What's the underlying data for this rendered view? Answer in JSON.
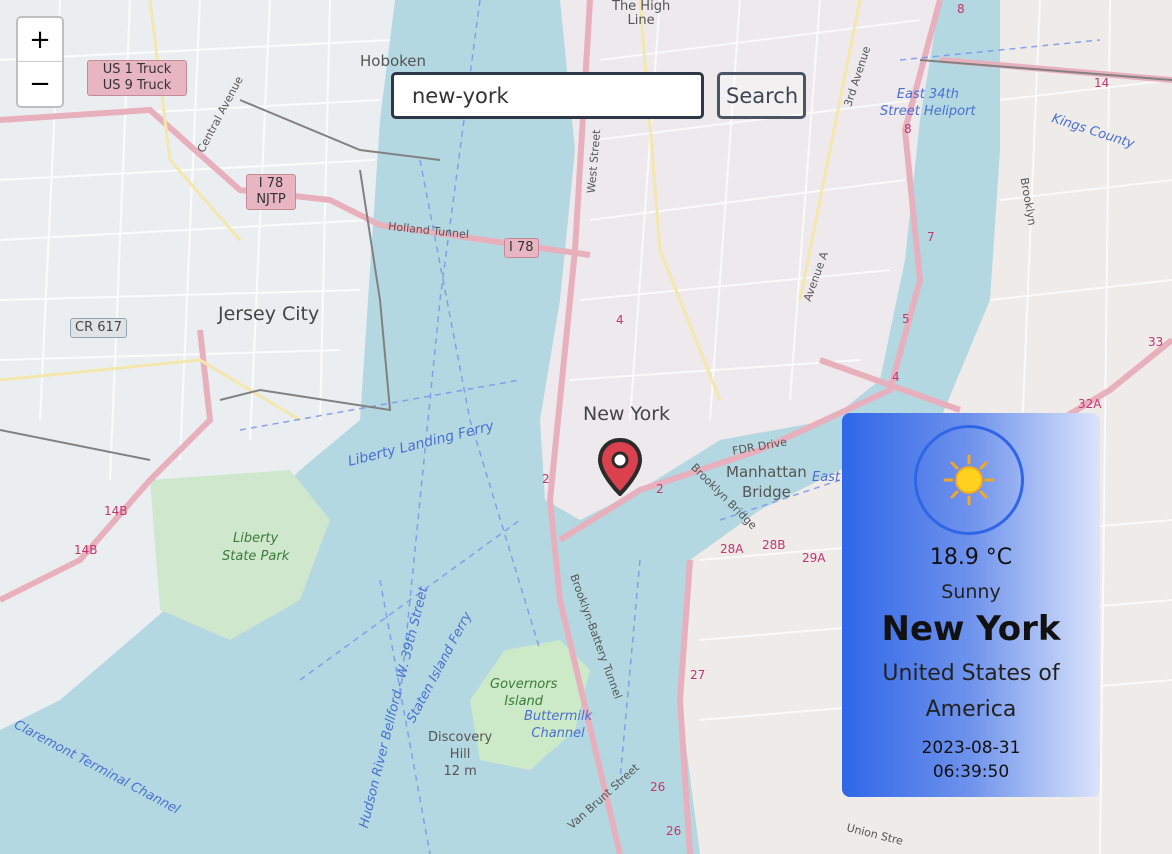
{
  "map": {
    "place_labels": {
      "hoboken": "Hoboken",
      "jersey_city": "Jersey City",
      "new_york": "New York",
      "manhattan_bridge": "Manhattan\nBridge",
      "the_high_line": "The High\nLine",
      "liberty_state_park": "Liberty\nState Park",
      "governors_island": "Governors\nIsland",
      "discovery_hill": "Discovery\nHill\n12 m",
      "buttermilk_channel": "Buttermilk\nChannel",
      "east_34th_heliport": "East 34th\nStreet Heliport",
      "kings_county": "Kings County",
      "liberty_landing_ferry": "Liberty Landing Ferry",
      "holland_tunnel": "Holland Tunnel",
      "fdr_drive": "FDR Drive",
      "brooklyn_bridge": "Brooklyn Bridge",
      "west_street": "West Street",
      "central_avenue": "Central Avenue",
      "van_brunt_street": "Van Brunt Street",
      "union_street": "Union Stre",
      "claremont_channel": "Claremont Terminal Channel",
      "hudson_river": "Hudson River Bellford - W. 39th Street",
      "staten_island_ferry": "Staten Island Ferry",
      "brooklyn_battery_tunnel": "Brooklyn-Battery Tunnel",
      "avenue_a": "Avenue A",
      "third_avenue": "3rd Avenue",
      "brooklyn": "Brooklyn",
      "east": "East"
    },
    "shields": {
      "us1": "US 1 Truck\nUS 9 Truck",
      "i78_njtp": "I 78\nNJTP",
      "i78": "I 78",
      "cr617": "CR 617"
    },
    "exit_numbers": [
      "8",
      "14",
      "8",
      "7",
      "5",
      "4",
      "4",
      "2",
      "2",
      "28A",
      "28B",
      "29A",
      "27",
      "26",
      "26",
      "14B",
      "14B",
      "32A",
      "33",
      "2"
    ]
  },
  "zoom": {
    "in_label": "+",
    "out_label": "−"
  },
  "search": {
    "value": "new-york",
    "button_label": "Search"
  },
  "marker": {
    "icon": "map-pin-icon",
    "color": "#d9414f"
  },
  "weather": {
    "icon": "sun-icon",
    "temperature": "18.9 °C",
    "condition": "Sunny",
    "city": "New York",
    "country": "United States of America",
    "date": "2023-08-31",
    "time": "06:39:50",
    "accent": "#2f66e8"
  }
}
